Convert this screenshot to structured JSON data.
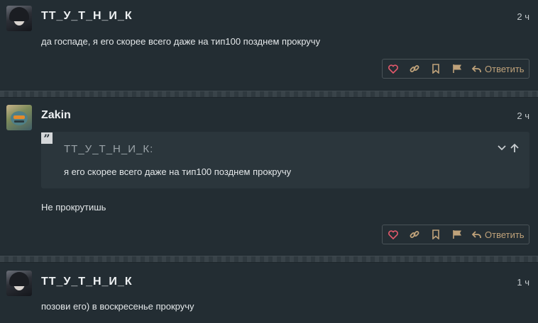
{
  "posts": [
    {
      "author": "ТТ_У_Т_Н_И_К",
      "time": "2 ч",
      "text": "да госпаде, я его скорее всего даже на тип100 позднем прокручу",
      "reply_label": "Ответить"
    },
    {
      "author": "Zakin",
      "time": "2 ч",
      "quote": {
        "author": "ТТ_У_Т_Н_И_К:",
        "text": "я его скорее всего даже на тип100 позднем прокручу"
      },
      "text": "Не прокрутишь",
      "reply_label": "Ответить"
    },
    {
      "author": "ТТ_У_Т_Н_И_К",
      "time": "1 ч",
      "text": "позови его) в воскресенье прокручу"
    }
  ],
  "icons": {
    "like": "heart-icon",
    "link": "link-icon",
    "bookmark": "bookmark-icon",
    "report": "flag-icon",
    "reply": "reply-arrow-icon",
    "quote": "quote-icon",
    "collapse": "chevron-down-icon",
    "goto": "arrow-up-icon"
  },
  "colors": {
    "background": "#222c32",
    "accent": "#bfa27a",
    "like": "#e3596b",
    "quote_bg": "#2b363c"
  }
}
